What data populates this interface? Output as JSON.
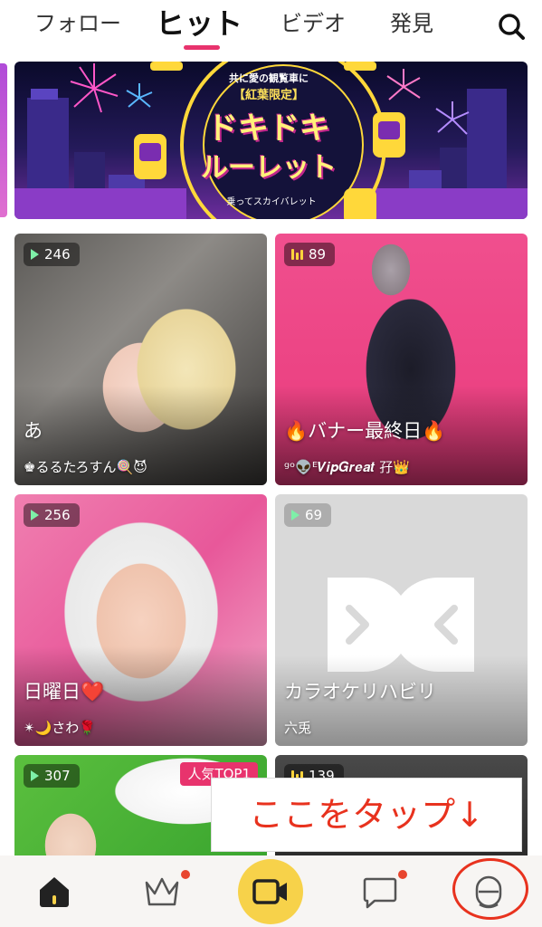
{
  "tabs": [
    {
      "label": "フォロー"
    },
    {
      "label": "ヒット"
    },
    {
      "label": "ビデオ"
    },
    {
      "label": "発見"
    }
  ],
  "active_tab": "ヒット",
  "banner": {
    "subtitle": "共に愛の観覧車に",
    "tag": "【紅葉限定】",
    "title_line1": "ドキドキ",
    "title_line2": "ルーレット",
    "caption": "乗ってスカイバレット"
  },
  "cards": [
    {
      "count": "246",
      "type": "video",
      "title": "あ",
      "user": "♚るるたろすん🍭😈"
    },
    {
      "count": "89",
      "type": "live",
      "title": "🔥バナー最終日🔥",
      "user": "ᵍᵒ👽ᴱ𝑽𝒊𝒑𝑮𝒓𝒆𝒂𝒕 孖👑"
    },
    {
      "count": "256",
      "type": "video",
      "title": "日曜日❤️",
      "user": "✴︎🌙さわ🌹"
    },
    {
      "count": "69",
      "type": "video",
      "title": "カラオケリハビリ",
      "user": "六兎"
    },
    {
      "count": "307",
      "type": "video",
      "rank_label": "人気TOP1"
    },
    {
      "count": "139",
      "type": "live"
    }
  ],
  "annotation": "ここをタップ↓",
  "bottom_nav": {
    "items": [
      "home-icon",
      "crown-icon",
      "video-camera-icon",
      "chat-icon",
      "profile-icon"
    ],
    "highlight_color": "#e8321e",
    "accent": "#f7d24a"
  },
  "colors": {
    "tab_indicator": "#e8336d",
    "notification_dot": "#e8452e"
  }
}
